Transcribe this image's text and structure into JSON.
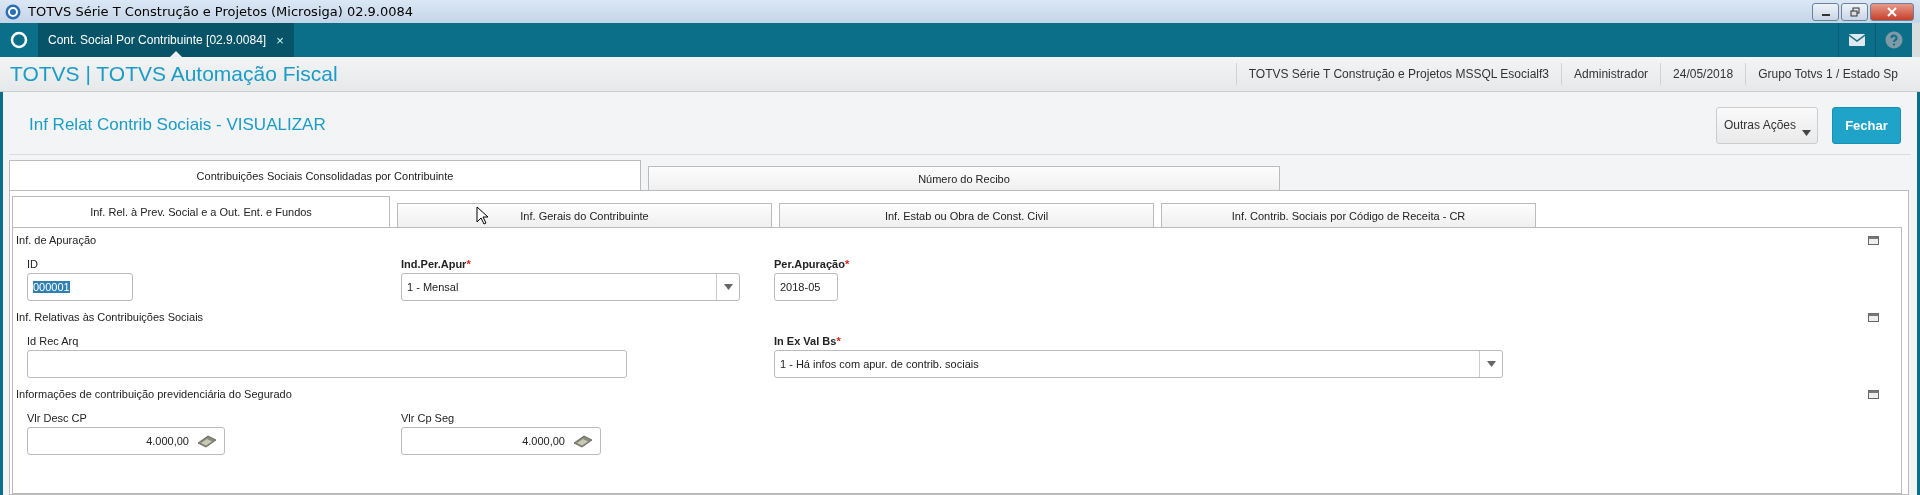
{
  "window": {
    "title": "TOTVS Série T Construção e Projetos (Microsiga) 02.9.0084"
  },
  "app_tabs": [
    {
      "label": "Cont. Social Por Contribuinte [02.9.0084]",
      "close": "×",
      "selected": true
    }
  ],
  "header": {
    "brand": "TOTVS | TOTVS Automação Fiscal",
    "info": [
      "TOTVS Série T Construção e Projetos MSSQL Esocialf3",
      "Administrador",
      "24/05/2018",
      "Grupo Totvs 1 / Estado Sp"
    ]
  },
  "page": {
    "title": "Inf Relat Contrib Sociais - VISUALIZAR",
    "buttons": [
      {
        "label": "Outras Ações",
        "kind": "menu"
      },
      {
        "label": "Fechar",
        "kind": "primary"
      }
    ]
  },
  "outer_tabs": [
    {
      "label": "Contribuições Sociais Consolidadas por Contribuinte",
      "selected": true
    },
    {
      "label": "Número do Recibo",
      "selected": false
    }
  ],
  "inner_tabs": [
    {
      "label": "Inf. Rel. à Prev. Social e a Out. Ent. e Fundos",
      "selected": true
    },
    {
      "label": "Inf. Gerais do Contribuinte",
      "selected": false
    },
    {
      "label": "Inf. Estab ou Obra de Const. Civil",
      "selected": false
    },
    {
      "label": "Inf. Contrib. Sociais por Código de Receita - CR",
      "selected": false
    }
  ],
  "sections": [
    {
      "title": "Inf. de Apuração",
      "fields": [
        {
          "kind": "text",
          "label": "ID",
          "value": "000001",
          "highlighted": true
        },
        {
          "kind": "select",
          "label": "Ind.Per.Apur",
          "required_mark": "*",
          "value": "1 - Mensal"
        },
        {
          "kind": "text",
          "label": "Per.Apuração",
          "required_mark": "*",
          "value": "2018-05",
          "highlighted": false
        }
      ]
    },
    {
      "title": "Inf. Relativas às Contribuições Sociais",
      "fields": [
        {
          "kind": "text",
          "label": "Id Rec Arq"
        },
        {
          "kind": "select",
          "label": "In Ex Val Bs",
          "required_mark": "*",
          "value": "1 -  Há infos com apur. de contrib. sociais"
        }
      ]
    },
    {
      "title": "Informações de contribuição previdenciária do Segurado",
      "fields": [
        {
          "kind": "currency",
          "label": "Vlr Desc CP",
          "value": "4.000,00"
        },
        {
          "kind": "currency",
          "label": "Vlr Cp Seg",
          "value": "4.000,00"
        }
      ]
    }
  ]
}
